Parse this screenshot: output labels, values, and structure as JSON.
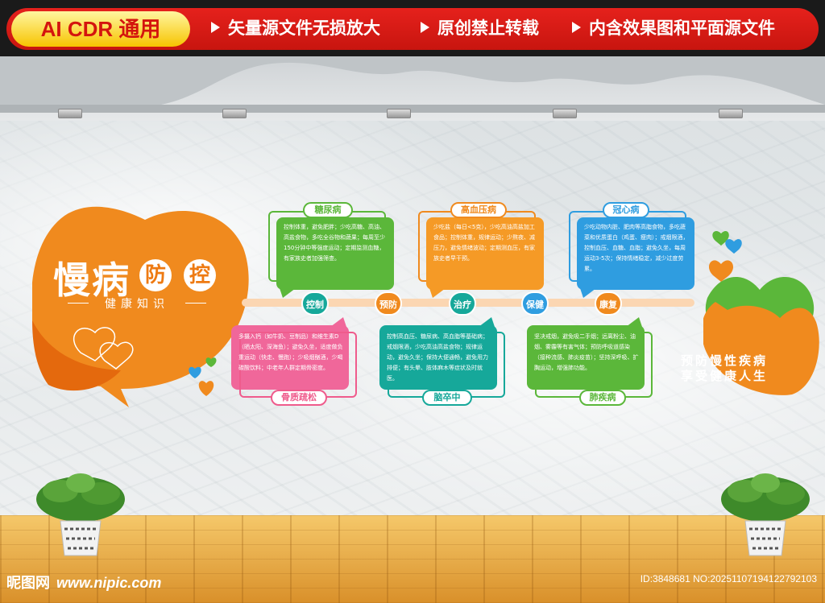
{
  "banner": {
    "tag": "AI CDR 通用",
    "items": [
      "矢量源文件无损放大",
      "原创禁止转载",
      "内含效果图和平面源文件"
    ]
  },
  "main": {
    "title_a": "慢病",
    "title_b": "防",
    "title_c": "控",
    "subtitle": "健康知识"
  },
  "timeline": {
    "nodes": [
      "控制",
      "预防",
      "治疗",
      "保健",
      "康复"
    ]
  },
  "cards": {
    "diabetes": {
      "label": "糖尿病",
      "text": "控制体重，避免肥胖；少吃高糖、高油、高盐食物，多吃全谷物和蔬果；每周至少150分钟中等强度运动；定期监测血糖，有家族史者加强筛查。"
    },
    "hypertension": {
      "label": "高血压病",
      "text": "少吃盐（每日<5克），少吃高油高盐加工食品；控制体重，规律运动；少熬夜、减压力，避免情绪波动；定期测血压，有家族史者早干预。"
    },
    "coronary": {
      "label": "冠心病",
      "text": "少吃动物内脏、肥肉等高脂食物，多吃蔬菜和优质蛋白（鸡蛋、瘦肉）；戒烟限酒，控制血压、血糖、血脂；避免久坐，每周运动3-5次；保持情绪稳定，减少过度劳累。"
    },
    "osteoporosis": {
      "label": "骨质疏松",
      "text": "多摄入钙（如牛奶、豆制品）和维生素D（晒太阳、深海鱼）；避免久坐，适度做负重运动（快走、慢跑）；少吸烟酗酒，少喝碳酸饮料；中老年人群定期骨密度。"
    },
    "stroke": {
      "label": "脑卒中",
      "text": "控制高血压、糖尿病、高血脂等基础病；戒烟限酒，少吃高油高盐食物；规律运动，避免久坐；保持大便通畅，避免用力排便；有头晕、肢体麻木等症状及时就医。"
    },
    "lung": {
      "label": "肺疾病",
      "text": "坚决戒烟，避免吸二手烟；远离粉尘、油烟、雾霾等有害气体；预防呼吸道感染（接种流感、肺炎疫苗）；坚持深呼吸、扩胸运动，增强肺功能。"
    }
  },
  "slogan": {
    "line1": "预防慢性疾病",
    "line2": "享受健康人生"
  },
  "watermark": {
    "site_name": "昵图网",
    "url": "www.nipic.com",
    "id": "ID:3848681 NO:20251107194122792103"
  },
  "colors": {
    "orange": "#ee7a12",
    "green": "#5bb73a",
    "pink": "#ef5b8c",
    "teal": "#16a89a",
    "blue": "#2f9de0",
    "red_banner": "#e5211c"
  }
}
